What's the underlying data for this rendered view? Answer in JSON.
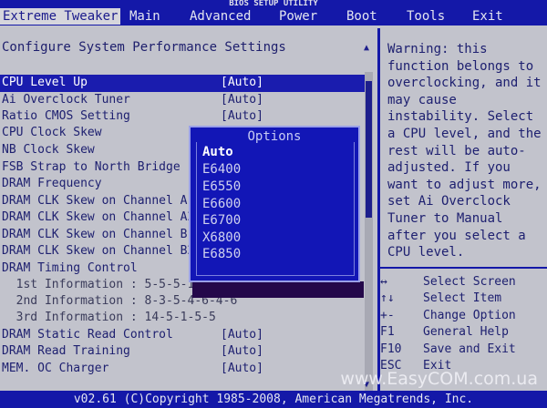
{
  "window": {
    "title": "BIOS SETUP UTILITY"
  },
  "menu": {
    "tabs": [
      {
        "label": "Extreme Tweaker"
      },
      {
        "label": "Main"
      },
      {
        "label": "Advanced"
      },
      {
        "label": "Power"
      },
      {
        "label": "Boot"
      },
      {
        "label": "Tools"
      },
      {
        "label": "Exit"
      }
    ]
  },
  "main": {
    "heading": "Configure System Performance Settings",
    "rows": [
      {
        "label": "CPU Level Up",
        "value": "[Auto]"
      },
      {
        "label": "Ai Overclock Tuner",
        "value": "[Auto]"
      },
      {
        "label": "Ratio CMOS Setting",
        "value": "[Auto]"
      },
      {
        "label": "CPU Clock Skew",
        "value": ""
      },
      {
        "label": "NB Clock Skew",
        "value": ""
      },
      {
        "label": "FSB Strap to North Bridge",
        "value": ""
      },
      {
        "label": "DRAM Frequency",
        "value": ""
      },
      {
        "label": "DRAM CLK Skew on Channel A1",
        "value": ""
      },
      {
        "label": "DRAM CLK Skew on Channel A2",
        "value": ""
      },
      {
        "label": "DRAM CLK Skew on Channel B1",
        "value": ""
      },
      {
        "label": "DRAM CLK Skew on Channel B2",
        "value": ""
      },
      {
        "label": "DRAM Timing Control",
        "value": ""
      },
      {
        "label": "  1st Information : 5-5-5-18-3-44-6-3",
        "value": ""
      },
      {
        "label": "  2nd Information : 8-3-5-4-6-4-6",
        "value": ""
      },
      {
        "label": "  3rd Information : 14-5-1-5-5",
        "value": ""
      },
      {
        "label": "DRAM Static Read Control",
        "value": "[Auto]"
      },
      {
        "label": "DRAM Read Training",
        "value": "[Auto]"
      },
      {
        "label": "MEM. OC Charger",
        "value": "[Auto]"
      }
    ]
  },
  "popup": {
    "title": "Options",
    "options": [
      "Auto",
      "E6400",
      "E6550",
      "E6600",
      "E6700",
      "X6800",
      "E6850"
    ],
    "selected": "Auto"
  },
  "help": {
    "text": "Warning: this function belongs to overclocking, and it may cause instability. Select a CPU level, and the rest will be auto-adjusted. If you want to adjust more, set Ai Overclock Tuner to Manual after you select a CPU level.",
    "keys": [
      {
        "key": "↔",
        "desc": "Select Screen"
      },
      {
        "key": "↑↓",
        "desc": "Select Item"
      },
      {
        "key": "+-",
        "desc": "Change Option"
      },
      {
        "key": "F1",
        "desc": "General Help"
      },
      {
        "key": "F10",
        "desc": "Save and Exit"
      },
      {
        "key": "ESC",
        "desc": "Exit"
      }
    ]
  },
  "footer": {
    "text": "v02.61 (C)Copyright 1985-2008, American Megatrends, Inc."
  },
  "watermark": {
    "text": "www.EasyCOM.com.ua"
  },
  "colors": {
    "background": "#c2c3cc",
    "menu_bar": "#1418a8",
    "popup": "#1216b6",
    "text": "#1e2070"
  }
}
